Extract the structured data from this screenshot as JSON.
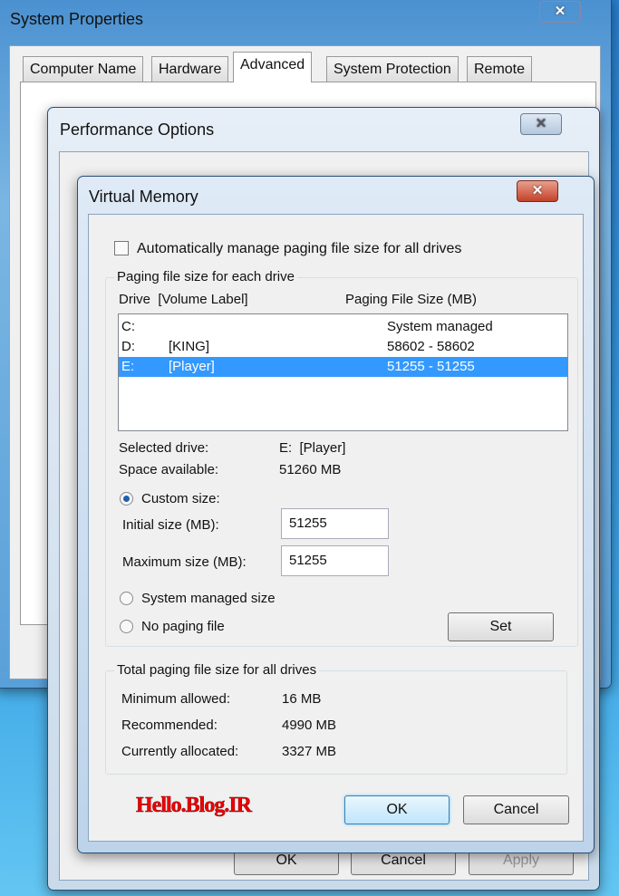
{
  "system_properties": {
    "title": "System Properties",
    "tabs": [
      "Computer Name",
      "Hardware",
      "Advanced",
      "System Protection",
      "Remote"
    ],
    "active_tab": "Advanced",
    "buttons": {
      "ok": "OK",
      "cancel": "Cancel",
      "apply": "Apply"
    }
  },
  "performance_options": {
    "title": "Performance Options",
    "active_tab": "Advanced"
  },
  "virtual_memory": {
    "title": "Virtual Memory",
    "auto_manage_label": "Automatically manage paging file size for all drives",
    "auto_manage_checked": false,
    "paging_group_label": "Paging file size for each drive",
    "columns": {
      "drive": "Drive  [Volume Label]",
      "size": "Paging File Size (MB)"
    },
    "drives": [
      {
        "drive": "C:",
        "label": "",
        "size": "System managed",
        "selected": false
      },
      {
        "drive": "D:",
        "label": "[KING]",
        "size": "58602 - 58602",
        "selected": false
      },
      {
        "drive": "E:",
        "label": "[Player]",
        "size": "51255 - 51255",
        "selected": true
      }
    ],
    "selected_drive_label": "Selected drive:",
    "selected_drive_value": "E:  [Player]",
    "space_available_label": "Space available:",
    "space_available_value": "51260 MB",
    "custom_size_label": "Custom size:",
    "initial_size_label": "Initial size (MB):",
    "initial_size_value": "51255",
    "maximum_size_label": "Maximum size (MB):",
    "maximum_size_value": "51255",
    "system_managed_label": "System managed size",
    "no_paging_label": "No paging file",
    "selected_option": "Custom size",
    "set_label": "Set",
    "total_group_label": "Total paging file size for all drives",
    "minimum_label": "Minimum allowed:",
    "minimum_value": "16 MB",
    "recommended_label": "Recommended:",
    "recommended_value": "4990 MB",
    "allocated_label": "Currently allocated:",
    "allocated_value": "3327 MB",
    "ok_label": "OK",
    "cancel_label": "Cancel",
    "watermark": "Hello.Blog.IR",
    "selection_color": "#3399ff"
  }
}
